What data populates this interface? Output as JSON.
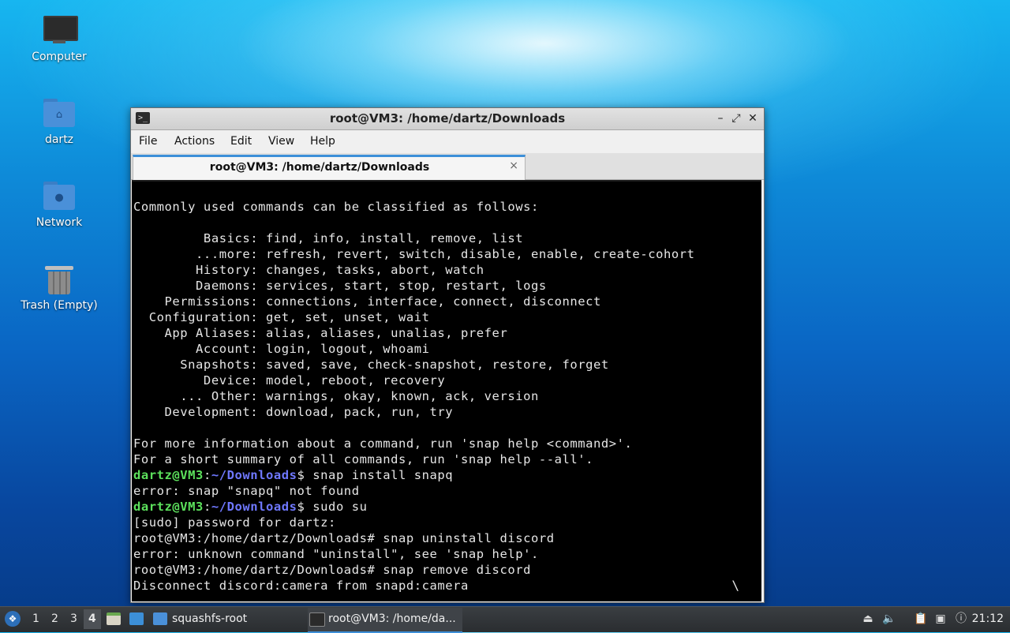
{
  "desktop": {
    "icons": [
      {
        "label": "Computer",
        "icon": "computer-icon"
      },
      {
        "label": "dartz",
        "icon": "home-folder-icon"
      },
      {
        "label": "Network",
        "icon": "network-folder-icon"
      },
      {
        "label": "Trash (Empty)",
        "icon": "trash-icon"
      }
    ]
  },
  "window": {
    "title": "root@VM3: /home/dartz/Downloads",
    "controls": {
      "minimize": "–",
      "maximize": "⤢",
      "close": "✕"
    },
    "menu": [
      "File",
      "Actions",
      "Edit",
      "View",
      "Help"
    ],
    "tab": {
      "label": "root@VM3: /home/dartz/Downloads",
      "close": "×"
    }
  },
  "terminal": {
    "lines": [
      {
        "text": "Commonly used commands can be classified as follows:"
      },
      {
        "text": ""
      },
      {
        "text": "         Basics: find, info, install, remove, list"
      },
      {
        "text": "        ...more: refresh, revert, switch, disable, enable, create-cohort"
      },
      {
        "text": "        History: changes, tasks, abort, watch"
      },
      {
        "text": "        Daemons: services, start, stop, restart, logs"
      },
      {
        "text": "    Permissions: connections, interface, connect, disconnect"
      },
      {
        "text": "  Configuration: get, set, unset, wait"
      },
      {
        "text": "    App Aliases: alias, aliases, unalias, prefer"
      },
      {
        "text": "        Account: login, logout, whoami"
      },
      {
        "text": "      Snapshots: saved, save, check-snapshot, restore, forget"
      },
      {
        "text": "         Device: model, reboot, recovery"
      },
      {
        "text": "      ... Other: warnings, okay, known, ack, version"
      },
      {
        "text": "    Development: download, pack, run, try"
      },
      {
        "text": ""
      },
      {
        "text": "For more information about a command, run 'snap help <command>'."
      },
      {
        "text": "For a short summary of all commands, run 'snap help --all'."
      },
      {
        "user": "dartz@VM3",
        "sep": ":",
        "path": "~/Downloads",
        "cmd": "$ snap install snapq"
      },
      {
        "text": "error: snap \"snapq\" not found"
      },
      {
        "user": "dartz@VM3",
        "sep": ":",
        "path": "~/Downloads",
        "cmd": "$ sudo su"
      },
      {
        "text": "[sudo] password for dartz:"
      },
      {
        "text": "root@VM3:/home/dartz/Downloads# snap uninstall discord"
      },
      {
        "text": "error: unknown command \"uninstall\", see 'snap help'."
      },
      {
        "text": "root@VM3:/home/dartz/Downloads# snap remove discord"
      },
      {
        "text": "Disconnect discord:camera from snapd:camera"
      }
    ],
    "spinner": "\\",
    "colors": {
      "background": "#000000",
      "foreground": "#e6e6e6",
      "user": "#5ce05c",
      "path": "#6f78ff"
    }
  },
  "taskbar": {
    "workspaces": [
      "1",
      "2",
      "3",
      "4"
    ],
    "active_workspace": "4",
    "tasks": [
      {
        "label": "squashfs-root",
        "icon": "folder-icon"
      },
      {
        "label": "root@VM3: /home/da...",
        "icon": "terminal-icon",
        "active": true
      }
    ],
    "clock": "21:12"
  }
}
